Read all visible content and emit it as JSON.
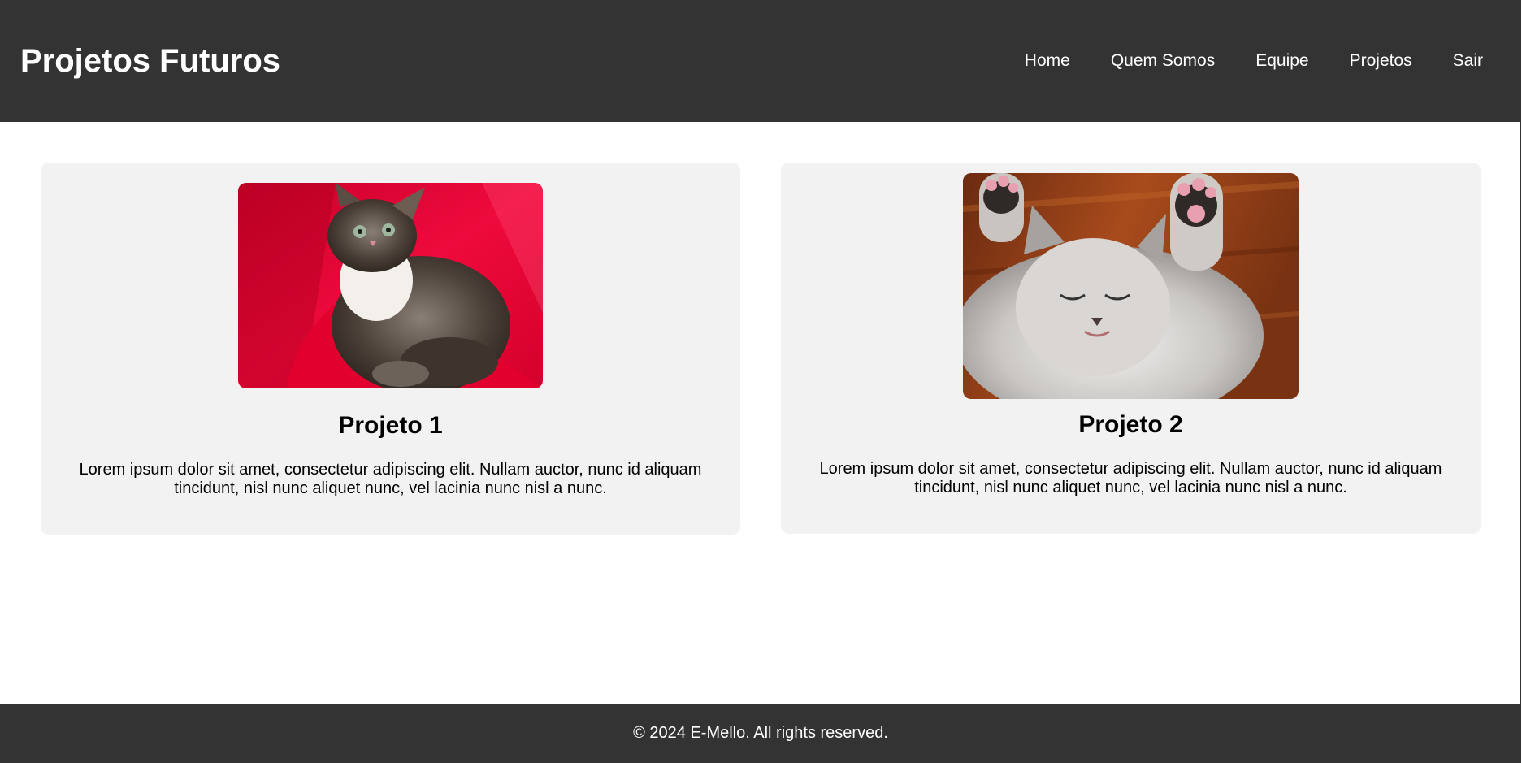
{
  "header": {
    "title": "Projetos Futuros",
    "nav": [
      "Home",
      "Quem Somos",
      "Equipe",
      "Projetos",
      "Sair"
    ]
  },
  "projects": [
    {
      "title": "Projeto 1",
      "description": "Lorem ipsum dolor sit amet, consectetur adipiscing elit. Nullam auctor, nunc id aliquam tincidunt, nisl nunc aliquet nunc, vel lacinia nunc nisl a nunc.",
      "image": "kitten-photo-red-background"
    },
    {
      "title": "Projeto 2",
      "description": "Lorem ipsum dolor sit amet, consectetur adipiscing elit. Nullam auctor, nunc id aliquam tincidunt, nisl nunc aliquet nunc, vel lacinia nunc nisl a nunc.",
      "image": "sleeping-kitten-paws-up-photo"
    }
  ],
  "footer": {
    "text": "© 2024 E-Mello. All rights reserved."
  },
  "colors": {
    "header_bg": "#333333",
    "card_bg": "#f2f2f2",
    "page_bg": "#ffffff",
    "text_light": "#ffffff",
    "text_dark": "#000000"
  }
}
